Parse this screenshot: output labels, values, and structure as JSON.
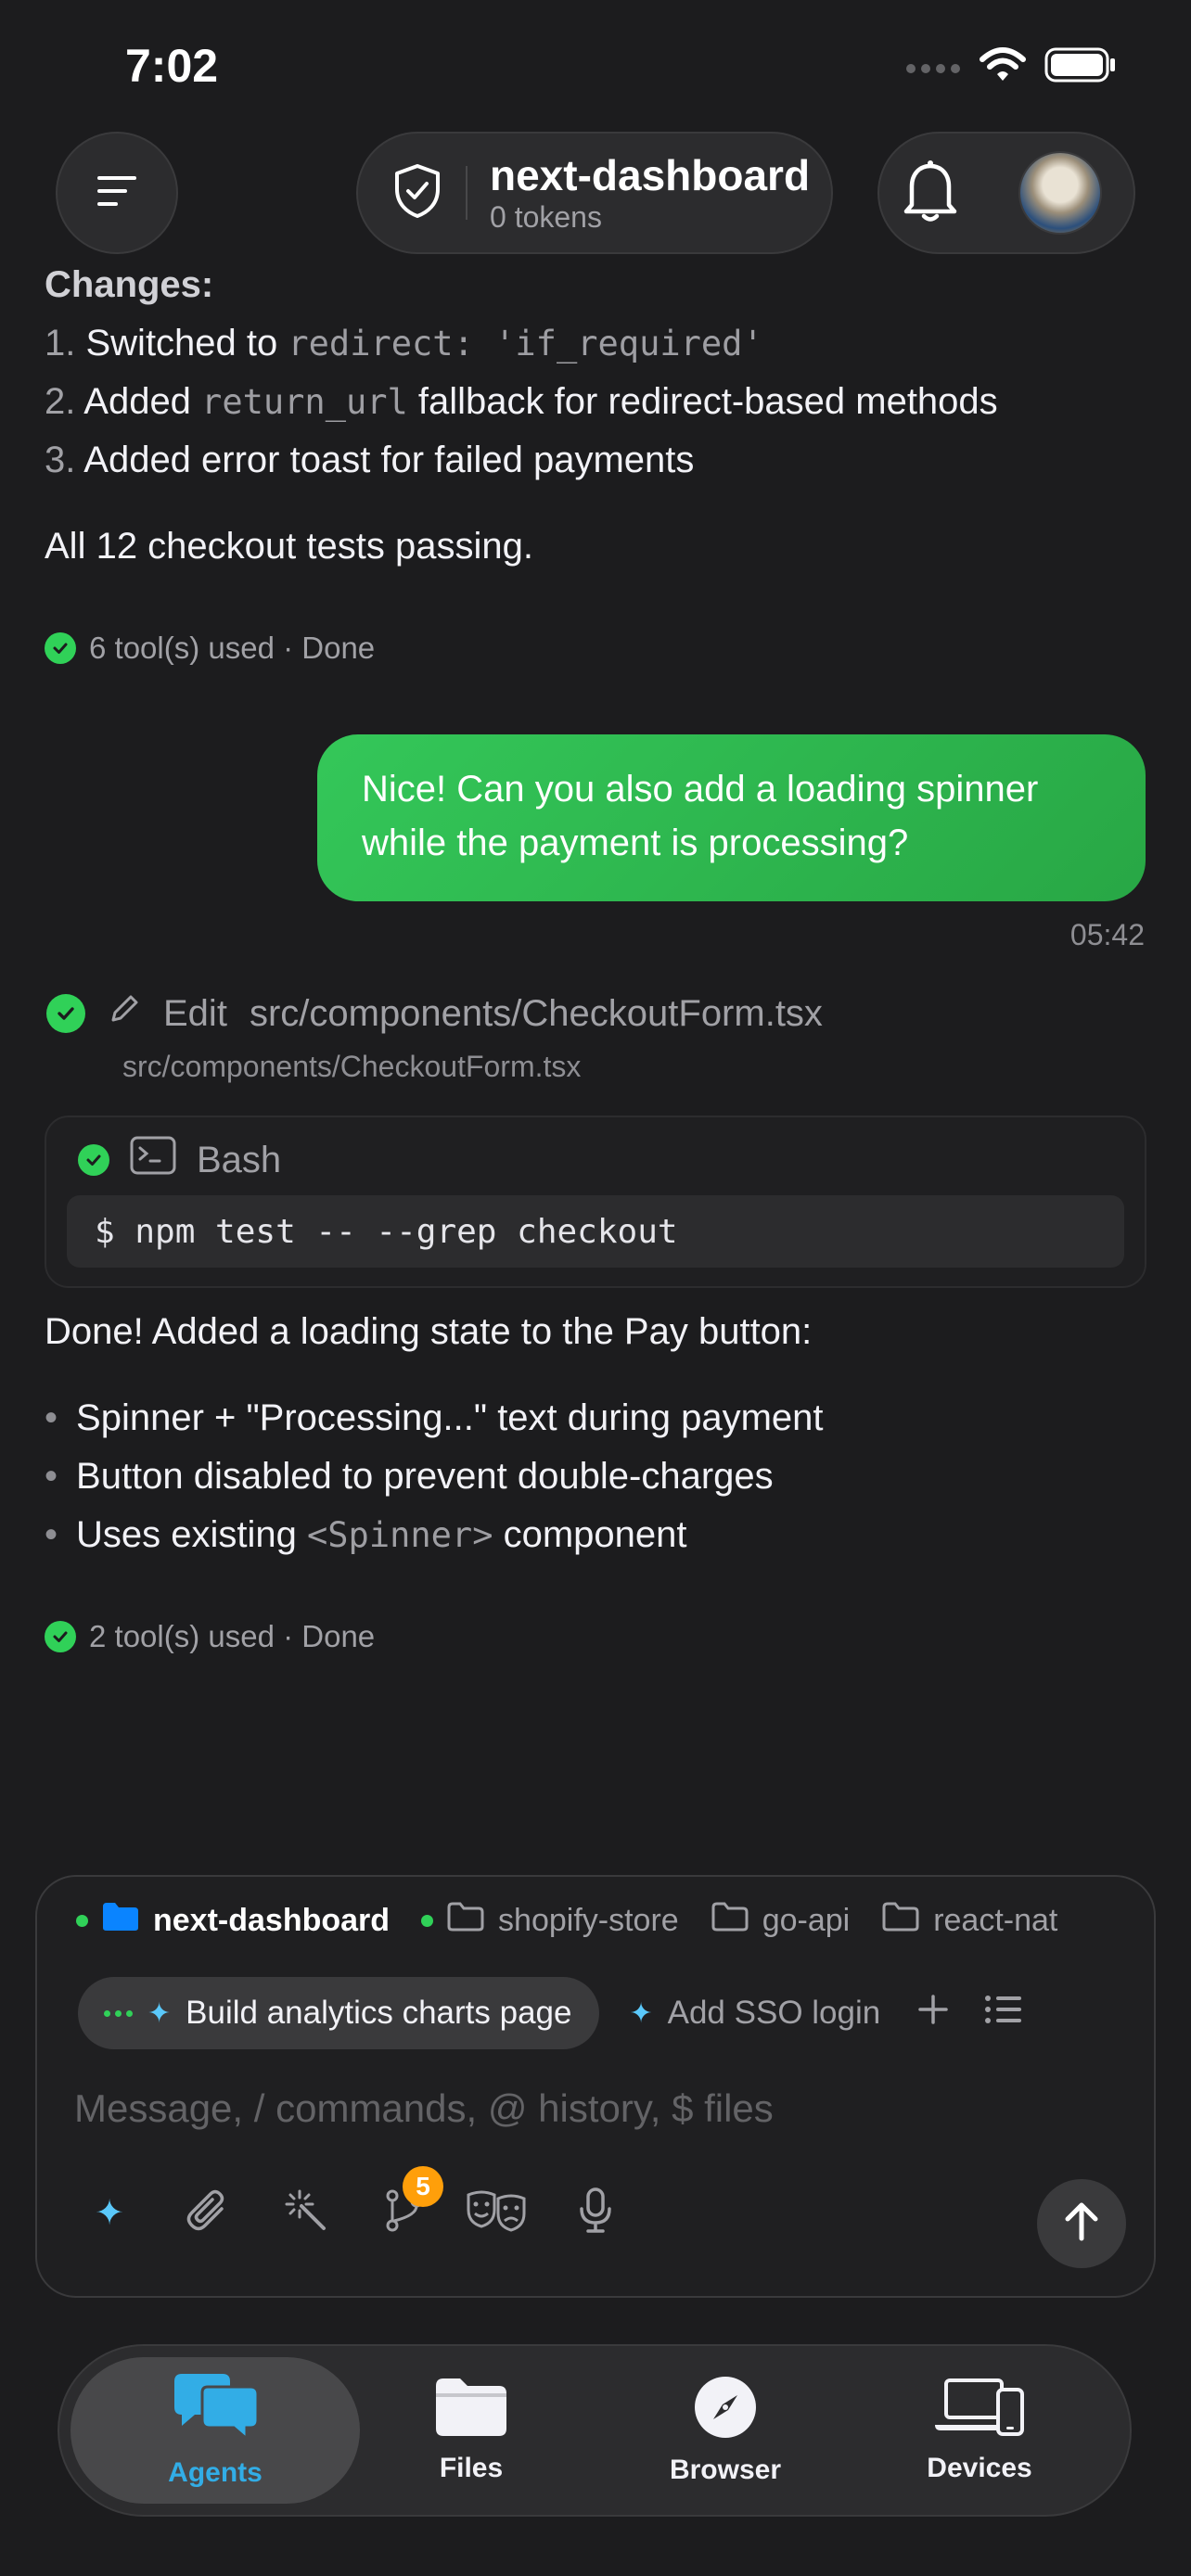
{
  "status": {
    "time": "7:02"
  },
  "header": {
    "project_title": "next-dashboard",
    "project_sub": "0 tokens"
  },
  "chat": {
    "changes_heading": "Changes:",
    "changes": [
      {
        "num": "1.",
        "pre": "Switched to ",
        "code": "redirect: 'if_required'",
        "post": ""
      },
      {
        "num": "2.",
        "pre": "Added ",
        "code": "return_url",
        "post": " fallback for redirect-based methods"
      },
      {
        "num": "3.",
        "pre": "Added error toast for failed payments",
        "code": "",
        "post": ""
      }
    ],
    "tests_line": "All 12 checkout tests passing.",
    "tools_used_1": "6 tool(s) used · Done",
    "user_message": "Nice! Can you also add a loading spinner while the payment is processing?",
    "user_time": "05:42",
    "edit_label": "Edit",
    "edit_path": "src/components/CheckoutForm.tsx",
    "edit_subpath": "src/components/CheckoutForm.tsx",
    "bash_label": "Bash",
    "bash_command": "$ npm test -- --grep checkout",
    "done_line": "Done! Added a loading state to the Pay button:",
    "bullets": [
      {
        "pre": "Spinner + \"Processing...\" text during payment",
        "code": "",
        "post": ""
      },
      {
        "pre": "Button disabled to prevent double-charges",
        "code": "",
        "post": ""
      },
      {
        "pre": "Uses existing ",
        "code": "<Spinner>",
        "post": " component"
      }
    ],
    "tools_used_2": "2 tool(s) used · Done"
  },
  "composer": {
    "projects": [
      "next-dashboard",
      "shopify-store",
      "go-api",
      "react-nat"
    ],
    "tasks": [
      "Build analytics charts page",
      "Add SSO login"
    ],
    "placeholder": "Message, / commands, @ history, $ files",
    "branch_badge": "5"
  },
  "tabs": [
    "Agents",
    "Files",
    "Browser",
    "Devices"
  ],
  "colors": {
    "accent_green": "#30d158",
    "accent_blue": "#32ade6",
    "badge_orange": "#ff9f0a"
  }
}
